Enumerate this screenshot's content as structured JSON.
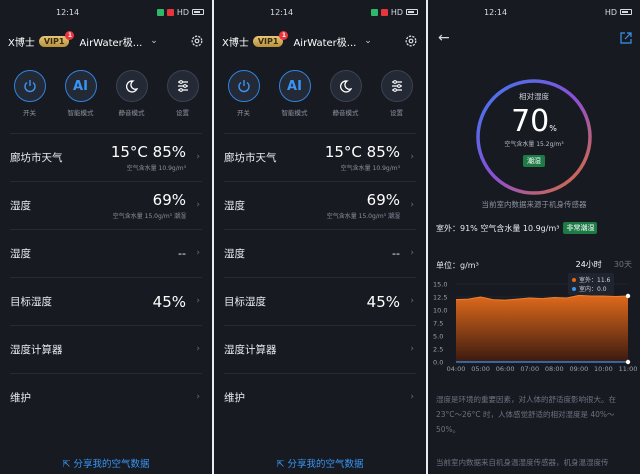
{
  "status": {
    "time": "12:14",
    "indicators": "HD",
    "battery_icon": "battery-icon",
    "wifi_icon": "wifi-icon"
  },
  "header": {
    "brand": "X博士",
    "vip": "VIP1",
    "vip_badge": "1",
    "device": "AirWater极...",
    "chevron": "⌄"
  },
  "modes": [
    {
      "label": "开关",
      "icon": "power-icon",
      "active": true
    },
    {
      "label": "智能模式",
      "icon_text": "AI",
      "icon": "ai-icon",
      "active": true
    },
    {
      "label": "静音模式",
      "icon": "moon-icon",
      "active": false
    },
    {
      "label": "设置",
      "icon": "sliders-icon",
      "active": false
    }
  ],
  "rows": [
    {
      "name": "廊坊市天气",
      "value": "15°C  85%",
      "sub": "空气含水量  10.9g/m³"
    },
    {
      "name": "湿度",
      "value": "69%",
      "sub": "空气含水量  15.0g/m³  潮湿"
    },
    {
      "name": "湿度",
      "value": "--"
    },
    {
      "name": "目标湿度",
      "value": "45%"
    },
    {
      "name": "湿度计算器"
    },
    {
      "name": "维护"
    }
  ],
  "share_label": "分享我的空气数据",
  "detail": {
    "gauge_title": "相对湿度",
    "gauge_value": "70",
    "gauge_unit": "%",
    "gauge_sub": "空气含水量 15.2g/m³",
    "gauge_badge": "潮湿",
    "source_note": "当前室内数据来源于机身传感器",
    "outdoor_text": "室外：91%  空气含水量 10.9g/m³",
    "outdoor_badge": "非常潮湿",
    "unit_label": "单位：g/m³",
    "tab_24h": "24小时",
    "tab_30d": "30天",
    "legend_outdoor": "室外：11.6",
    "legend_indoor": "室内：0.0",
    "description": "湿度是环境的重要因素，对人体的舒适度影响很大。在 23°C～26°C 时，人体感觉舒适的相对湿度是 40%～50%。",
    "description2": "当前室内数据来自机身温湿度传感器，机身温湿度传"
  },
  "colors": {
    "background": "#171a21",
    "accent": "#3a95f2",
    "good_badge": "#1e7b46",
    "series_outdoor": "#e06a1b",
    "series_indoor": "#3a95f2"
  },
  "chart_data": {
    "type": "area",
    "x": [
      "04:00",
      "05:00",
      "06:00",
      "07:00",
      "08:00",
      "09:00",
      "10:00",
      "11:00"
    ],
    "yticks": [
      "15.0",
      "12.5",
      "10.0",
      "7.5",
      "5.0",
      "2.5",
      "0.0"
    ],
    "ylim": [
      0,
      15
    ],
    "series": [
      {
        "name": "室外",
        "values": [
          12.0,
          12.1,
          12.5,
          12.0,
          11.9,
          12.1,
          12.3,
          12.2,
          12.4,
          12.3,
          12.8,
          12.7,
          12.7,
          12.6,
          12.7
        ]
      },
      {
        "name": "室内",
        "values": [
          0.0,
          0.0,
          0.0,
          0.0,
          0.0,
          0.0,
          0.0,
          0.0,
          0.0,
          0.0,
          0.0,
          0.0,
          0.0,
          0.0,
          0.0
        ]
      }
    ]
  }
}
